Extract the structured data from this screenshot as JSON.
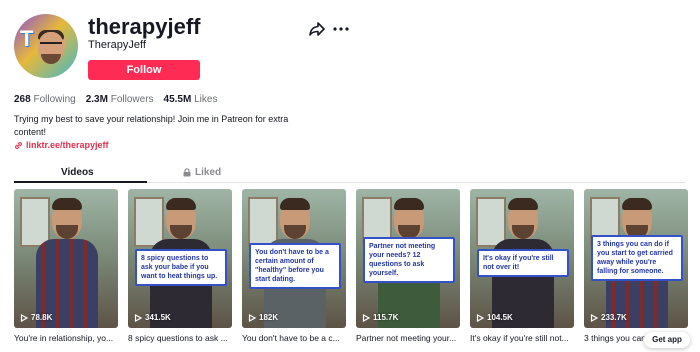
{
  "profile": {
    "username": "therapyjeff",
    "nickname": "TherapyJeff",
    "follow_label": "Follow",
    "stats": [
      {
        "value": "268",
        "label": "Following"
      },
      {
        "value": "2.3M",
        "label": "Followers"
      },
      {
        "value": "45.5M",
        "label": "Likes"
      }
    ],
    "bio": "Trying my best to save your relationship! Join me in Patreon for extra content!",
    "link": "linktr.ee/therapyjeff"
  },
  "tabs": [
    {
      "label": "Videos",
      "active": true
    },
    {
      "label": "Liked",
      "active": false,
      "icon": "lock-icon"
    }
  ],
  "videos": [
    {
      "views": "78.8K",
      "title": "You're in relationship, yo...",
      "overlay": ""
    },
    {
      "views": "341.5K",
      "title": "8 spicy questions to ask ...",
      "overlay": "8 spicy questions to ask your babe if you want to heat things up."
    },
    {
      "views": "182K",
      "title": "You don't have to be a c...",
      "overlay": "You don't have to be a certain amount of \"healthy\" before you start dating."
    },
    {
      "views": "115.7K",
      "title": "Partner not meeting your...",
      "overlay": "Partner not meeting your needs? 12 questions to ask yourself."
    },
    {
      "views": "104.5K",
      "title": "It's okay if you're still not...",
      "overlay": "It's okay if you're still not over it!"
    },
    {
      "views": "233.7K",
      "title": "3 things you can do if yo...",
      "overlay": "3 things you can do if you start to get carried away while you're falling for someone."
    }
  ],
  "get_app_label": "Get app",
  "colors": {
    "accent": "#fe2c55",
    "link": "#e0304d",
    "overlay_border": "#3451c7"
  }
}
